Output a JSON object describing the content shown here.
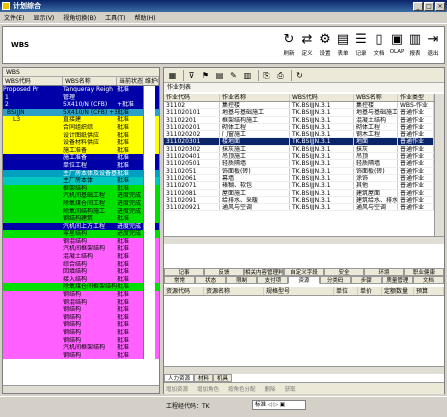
{
  "window": {
    "title": "计划综合",
    "min": "_",
    "max": "□",
    "close": "×"
  },
  "menu": [
    "文件(E)",
    "显示(V)",
    "视角切换(B)",
    "工具(T)",
    "帮助(H)"
  ],
  "toolbar": {
    "label": "WBS",
    "tools": [
      {
        "icon": "↻",
        "label": "刷新",
        "name": "refresh-icon"
      },
      {
        "icon": "⇄",
        "label": "定义",
        "name": "define-icon"
      },
      {
        "icon": "⚙",
        "label": "设置",
        "name": "settings-icon"
      },
      {
        "icon": "▤",
        "label": "表单",
        "name": "form-icon"
      },
      {
        "icon": "☰",
        "label": "记录",
        "name": "record-icon"
      },
      {
        "icon": "▯",
        "label": "文档",
        "name": "document-icon"
      },
      {
        "icon": "▣",
        "label": "OLAP",
        "name": "olap-icon"
      },
      {
        "icon": "▥",
        "label": "报表",
        "name": "report-icon"
      },
      {
        "icon": "⇥",
        "label": "退出",
        "name": "exit-icon"
      }
    ]
  },
  "wbs_tree": {
    "title": "WBS",
    "columns": [
      "WBS代码",
      "WBS名称",
      "当前状态",
      "维护权限"
    ],
    "rows": [
      {
        "code": "Proposed Pr",
        "name": "Tanqueray Reigh",
        "status": "批准",
        "bg": "#0000a8",
        "fg": "#ffffff"
      },
      {
        "code": "1",
        "name": "管理",
        "status": "",
        "bg": "#0000a8",
        "fg": "#ffffff"
      },
      {
        "code": "2",
        "name": "5X410/N (CFB)",
        "status": "+批准",
        "bg": "#0000a8",
        "fg": "#ffffff"
      },
      {
        "code": "BSIJJN",
        "name": "5X410/N (CFB) +3",
        "status": "批准",
        "bg": "#2aa0c8",
        "fg": "#000000"
      },
      {
        "code": "L3",
        "name": "直接建",
        "status": "批准",
        "bg": "#ffff00",
        "fg": "#000000"
      },
      {
        "code": "",
        "name": "合同组织综",
        "status": "批准",
        "bg": "#ffff00",
        "fg": "#000000"
      },
      {
        "code": "",
        "name": "设计图纸供应",
        "status": "批准",
        "bg": "#ffff00",
        "fg": "#000000"
      },
      {
        "code": "",
        "name": "设备材料供应",
        "status": "批准",
        "bg": "#ffff00",
        "fg": "#000000"
      },
      {
        "code": "",
        "name": "施工准备",
        "status": "批准",
        "bg": "#ffff00",
        "fg": "#000000"
      },
      {
        "code": "",
        "name": "施工准备",
        "status": "批准",
        "bg": "#0000a8",
        "fg": "#ffffff"
      },
      {
        "code": "",
        "name": "单位工程",
        "status": "批准",
        "bg": "#0000a8",
        "fg": "#ffffff"
      },
      {
        "code": "",
        "name": "主厂房本体及设备基础",
        "status": "批准",
        "bg": "#00a0c0",
        "fg": "#ffffff"
      },
      {
        "code": "",
        "name": "主厂房本体",
        "status": "批准",
        "bg": "#00c8c0",
        "fg": "#000000"
      },
      {
        "code": "",
        "name": "框架结构",
        "status": "批准",
        "bg": "#00e000",
        "fg": "#000000"
      },
      {
        "code": "",
        "name": "汽机间基础工程",
        "status": "进度完成",
        "bg": "#00e000",
        "fg": "#000000"
      },
      {
        "code": "",
        "name": "除氧煤仓间工程",
        "status": "进度完成",
        "bg": "#00e000",
        "fg": "#000000"
      },
      {
        "code": "",
        "name": "除氧间结构施工",
        "status": "进度完成",
        "bg": "#00e000",
        "fg": "#000000"
      },
      {
        "code": "",
        "name": "钢结构建筑",
        "status": "批准",
        "bg": "#00e000",
        "fg": "#000000"
      },
      {
        "code": "",
        "name": "汽机间上方工程",
        "status": "进度完成",
        "bg": "#0000a8",
        "fg": "#ffffff"
      },
      {
        "code": "",
        "name": "零星结构",
        "status": "进度完成",
        "bg": "#00e000",
        "fg": "#000000"
      },
      {
        "code": "",
        "name": "钢混结构",
        "status": "批准",
        "bg": "#ff60ff",
        "fg": "#000000"
      },
      {
        "code": "",
        "name": "汽机间框架结构",
        "status": "批准",
        "bg": "#ff60ff",
        "fg": "#000000"
      },
      {
        "code": "",
        "name": "混凝土结构",
        "status": "批准",
        "bg": "#ff60ff",
        "fg": "#000000"
      },
      {
        "code": "",
        "name": "综合结构",
        "status": "批准",
        "bg": "#ff60ff",
        "fg": "#000000"
      },
      {
        "code": "",
        "name": "回填结构",
        "status": "批准",
        "bg": "#ff60ff",
        "fg": "#000000"
      },
      {
        "code": "",
        "name": "接入结构",
        "status": "批准",
        "bg": "#ff60ff",
        "fg": "#000000"
      },
      {
        "code": "",
        "name": "除氧煤仓间框架结构",
        "status": "批准",
        "bg": "#00e000",
        "fg": "#000000"
      },
      {
        "code": "",
        "name": "钢结构",
        "status": "批准",
        "bg": "#ff60ff",
        "fg": "#000000"
      },
      {
        "code": "",
        "name": "钢混结构",
        "status": "批准",
        "bg": "#ff60ff",
        "fg": "#000000"
      },
      {
        "code": "",
        "name": "钢结构",
        "status": "批准",
        "bg": "#ff60ff",
        "fg": "#000000"
      },
      {
        "code": "",
        "name": "钢结构",
        "status": "批准",
        "bg": "#ff60ff",
        "fg": "#000000"
      },
      {
        "code": "",
        "name": "钢结构",
        "status": "批准",
        "bg": "#ff60ff",
        "fg": "#000000"
      },
      {
        "code": "",
        "name": "钢结构",
        "status": "批准",
        "bg": "#ff60ff",
        "fg": "#000000"
      },
      {
        "code": "",
        "name": "钢结构",
        "status": "批准",
        "bg": "#ff60ff",
        "fg": "#000000"
      },
      {
        "code": "",
        "name": "汽机间框架结构",
        "status": "批准",
        "bg": "#ff60ff",
        "fg": "#000000"
      },
      {
        "code": "",
        "name": "钢结构",
        "status": "批准",
        "bg": "#ff60ff",
        "fg": "#000000"
      }
    ]
  },
  "activities": {
    "title": "作业列表",
    "columns": [
      "作业代码",
      "作业名称",
      "WBS代码",
      "WBS名称",
      "作业类型"
    ],
    "rows": [
      [
        "31102",
        "集控楼",
        "TK.BSIJJN.3.1",
        "集控楼",
        "WBS-作业"
      ],
      [
        "311020101",
        "地基与基础施工",
        "TK.BSIJJN.3.1",
        "地基与基础施工",
        "普通作业"
      ],
      [
        "31102201",
        "框架结构施工",
        "TK.BSIJJN.3.1",
        "混凝土结构",
        "普通作业"
      ],
      [
        "311020201",
        "砌体工程",
        "TK.BSIJJN.3.1",
        "砌体工程",
        "普通作业"
      ],
      [
        "311020202",
        "门窗施工",
        "TK.BSIJJN.3.1",
        "钢木工程",
        "普通作业"
      ],
      [
        "311020301",
        "楼地面",
        "TK.BSIJJN.3.1",
        "地面",
        "普通作业"
      ],
      [
        "311020302",
        "抹灰施工",
        "TK.BSIJJN.3.1",
        "抹灰",
        "普通作业"
      ],
      [
        "311020401",
        "吊顶施工",
        "TK.BSIJJN.3.1",
        "吊顶",
        "普通作业"
      ],
      [
        "311020501",
        "轻质隔墙",
        "TK.BSIJJN.3.1",
        "轻质隔墙",
        "普通作业"
      ],
      [
        "31102051",
        "饰面板(砖)",
        "TK.BSIJJN.3.1",
        "饰面板(砖)",
        "普通作业"
      ],
      [
        "31102061",
        "幕墙",
        "TK.BSIJJN.3.1",
        "涂饰",
        "普通作业"
      ],
      [
        "31102071",
        "裱糊、软包",
        "TK.BSIJJN.3.1",
        "其他",
        "普通作业"
      ],
      [
        "31102081",
        "屋面施工",
        "TK.BSIJJN.3.1",
        "建筑屋面",
        "普通作业"
      ],
      [
        "31102091",
        "给排水、采暖",
        "TK.BSIJJN.3.1",
        "建筑给水、排水及采暖",
        "普通作业"
      ],
      [
        "311020921",
        "通风与空调",
        "TK.BSIJJN.3.1",
        "通风与空调",
        "普通作业"
      ]
    ],
    "selected_index": 5
  },
  "detail_tabs_row1": [
    "记事",
    "反馈",
    "相关内容管理判断",
    "自定义字段",
    "安全",
    "环境",
    "职业健康"
  ],
  "detail_tabs_row2": [
    "常常",
    "状态",
    "限制",
    "支付项",
    "资源",
    "分类码",
    "步骤",
    "质量管理",
    "文档"
  ],
  "active_tab": "资源",
  "resource_columns": [
    "资源代码",
    "资源名称",
    "规格型号",
    "单位",
    "单价",
    "定额数量",
    "预算"
  ],
  "bottom_tabs": [
    "人力资源",
    "材料",
    "机具"
  ],
  "action_buttons": [
    "增加资源",
    "增加角色",
    "按角色分配",
    "删除",
    "获取"
  ],
  "status_bar": {
    "wbs_code_label": "工程经代码：TK",
    "mode": "标准 ◁ ▷ ▣"
  }
}
